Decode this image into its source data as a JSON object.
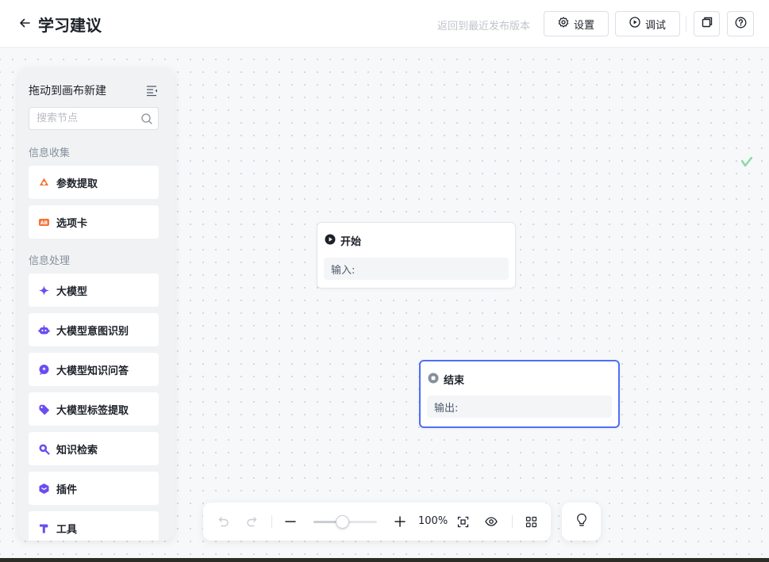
{
  "header": {
    "title": "学习建议",
    "revert_label": "返回到最近发布版本",
    "settings_label": "设置",
    "debug_label": "调试"
  },
  "panel": {
    "title": "拖动到画布新建",
    "search_placeholder": "搜索节点",
    "groups": [
      {
        "label": "信息收集",
        "items": [
          {
            "label": "参数提取",
            "icon": "param-extract-icon"
          },
          {
            "label": "选项卡",
            "icon": "ab-tab-icon"
          }
        ]
      },
      {
        "label": "信息处理",
        "items": [
          {
            "label": "大模型",
            "icon": "sparkle-icon"
          },
          {
            "label": "大模型意图识别",
            "icon": "robot-icon"
          },
          {
            "label": "大模型知识问答",
            "icon": "chat-bubble-icon"
          },
          {
            "label": "大模型标签提取",
            "icon": "tag-icon"
          },
          {
            "label": "知识检索",
            "icon": "search-icon"
          },
          {
            "label": "插件",
            "icon": "plugin-cube-icon"
          },
          {
            "label": "工具",
            "icon": "tool-icon"
          }
        ]
      }
    ]
  },
  "nodes": {
    "start": {
      "title": "开始",
      "field": "输入:"
    },
    "end": {
      "title": "结束",
      "field": "输出:"
    }
  },
  "toolbar": {
    "zoom_text": "100%",
    "zoom_level": 0.45
  },
  "colors": {
    "accent": "#4f6ef7",
    "orange": "#f77234",
    "purple": "#6b4df0",
    "green": "#2bc48a"
  }
}
